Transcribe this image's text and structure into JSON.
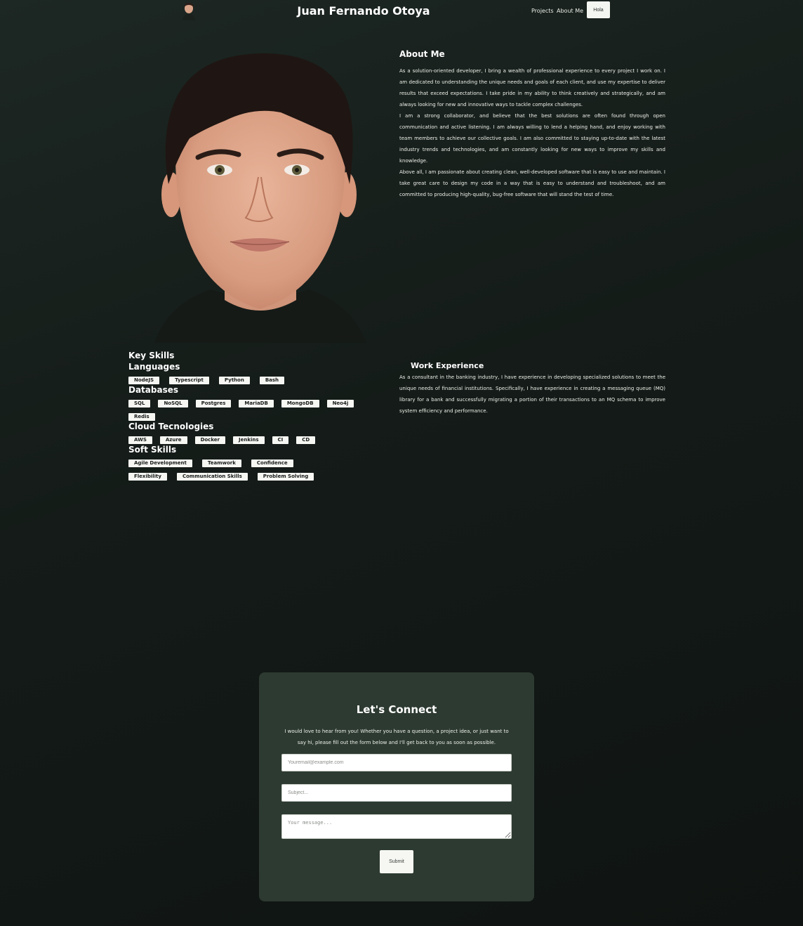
{
  "nav": {
    "title": "Juan Fernando Otoya",
    "links": [
      "Projects",
      "About Me"
    ],
    "button": "Hola"
  },
  "about": {
    "heading": "About Me",
    "paragraphs": [
      "As a solution-oriented developer, I bring a wealth of professional experience to every project I work on. I am dedicated to understanding the unique needs and goals of each client, and use my expertise to deliver results that exceed expectations. I take pride in my ability to think creatively and strategically, and am always looking for new and innovative ways to tackle complex challenges.",
      "I am a strong collaborator, and believe that the best solutions are often found through open communication and active listening. I am always willing to lend a helping hand, and enjoy working with team members to achieve our collective goals. I am also committed to staying up-to-date with the latest industry trends and technologies, and am constantly looking for new ways to improve my skills and knowledge.",
      "Above all, I am passionate about creating clean, well-developed software that is easy to use and maintain. I take great care to design my code in a way that is easy to understand and troubleshoot, and am committed to producing high-quality, bug-free software that will stand the test of time."
    ]
  },
  "skills": {
    "heading": "Key Skills",
    "groups": [
      {
        "title": "Languages",
        "items": [
          "NodeJS",
          "Typescript",
          "Python",
          "Bash"
        ]
      },
      {
        "title": "Databases",
        "items": [
          "SQL",
          "NoSQL",
          "Postgres",
          "MariaDB",
          "MongoDB",
          "Neo4j",
          "Redis"
        ]
      },
      {
        "title": "Cloud Tecnologies",
        "items": [
          "AWS",
          "Azure",
          "Docker",
          "Jenkins",
          "CI",
          "CD"
        ]
      },
      {
        "title": "Soft Skills",
        "items": [
          "Agile Development",
          "Teamwork",
          "Confidence",
          "Flexibility",
          "Communication Skills",
          "Problem Solving"
        ]
      }
    ]
  },
  "work": {
    "heading": "Work Experience",
    "text": "As a consultant in the banking industry, I have experience in developing specialized solutions to meet the unique needs of financial institutions. Specifically, I have experience in creating a messaging queue (MQ) library for a bank and successfully migrating a portion of their transactions to an MQ schema to improve system efficiency and performance."
  },
  "contact": {
    "heading": "Let's Connect",
    "intro": "I would love to hear from you! Whether you have a question, a project idea, or just want to say hi, please fill out the form below and I'll get back to you as soon as possible.",
    "email_placeholder": "Youremail@example.com",
    "subject_placeholder": "Subject...",
    "message_placeholder": "Your message...",
    "submit": "Submit"
  },
  "icons": {
    "nav_avatar": "avatar-icon",
    "portrait": "profile-photo"
  }
}
